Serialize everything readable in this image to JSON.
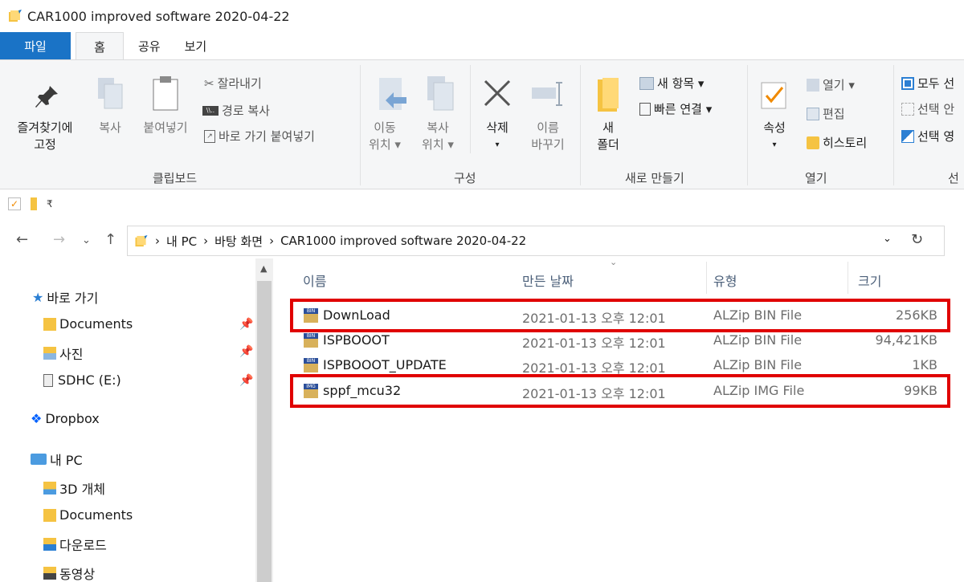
{
  "window": {
    "title": "CAR1000 improved software 2020-04-22"
  },
  "tabs": [
    {
      "label": "파일"
    },
    {
      "label": "홈"
    },
    {
      "label": "공유"
    },
    {
      "label": "보기"
    }
  ],
  "ribbon": {
    "clipboard": {
      "pin_label_1": "즐겨찾기에",
      "pin_label_2": "고정",
      "copy": "복사",
      "paste": "붙여넣기",
      "cut": "잘라내기",
      "copy_path": "경로 복사",
      "paste_shortcut": "바로 가기 붙여넣기",
      "group": "클립보드"
    },
    "organize": {
      "move_1": "이동",
      "move_2": "위치 ▾",
      "copy_1": "복사",
      "copy_2": "위치 ▾",
      "delete": "삭제",
      "delete_arrow": "▾",
      "rename_1": "이름",
      "rename_2": "바꾸기",
      "group": "구성"
    },
    "new": {
      "new_item": "새 항목 ▾",
      "easy_access": "빠른 연결 ▾",
      "folder_1": "새",
      "folder_2": "폴더",
      "group": "새로 만들기"
    },
    "open": {
      "properties": "속성",
      "properties_arrow": "▾",
      "open": "열기 ▾",
      "edit": "편집",
      "history": "히스토리",
      "group": "열기"
    },
    "select": {
      "all": "모두 선",
      "none": "선택 안",
      "invert": "선택 영",
      "group": "선"
    }
  },
  "address": {
    "crumbs": [
      "내 PC",
      "바탕 화면",
      "CAR1000 improved software 2020-04-22"
    ],
    "sep": "›"
  },
  "nav": {
    "quick_access": "바로 가기",
    "items": [
      "Documents",
      "사진",
      "SDHC (E:)"
    ],
    "dropbox": "Dropbox",
    "this_pc": "내 PC",
    "pc_items": [
      "3D 개체",
      "Documents",
      "다운로드",
      "동영상"
    ]
  },
  "files": {
    "headers": {
      "name": "이름",
      "date": "만든 날짜",
      "type": "유형",
      "size": "크기"
    },
    "rows": [
      {
        "name": "DownLoad",
        "date": "2021-01-13 오후 12:01",
        "type": "ALZip BIN File",
        "size": "256KB",
        "icon": "BIN"
      },
      {
        "name": "ISPBOOOT",
        "date": "2021-01-13 오후 12:01",
        "type": "ALZip BIN File",
        "size": "94,421KB",
        "icon": "BIN"
      },
      {
        "name": "ISPBOOOT_UPDATE",
        "date": "2021-01-13 오후 12:01",
        "type": "ALZip BIN File",
        "size": "1KB",
        "icon": "BIN"
      },
      {
        "name": "sppf_mcu32",
        "date": "2021-01-13 오후 12:01",
        "type": "ALZip IMG File",
        "size": "99KB",
        "icon": "IMG"
      }
    ]
  },
  "colors": {
    "accent": "#1a73c6",
    "highlight": "#e00000",
    "folder": "#f5c342"
  }
}
